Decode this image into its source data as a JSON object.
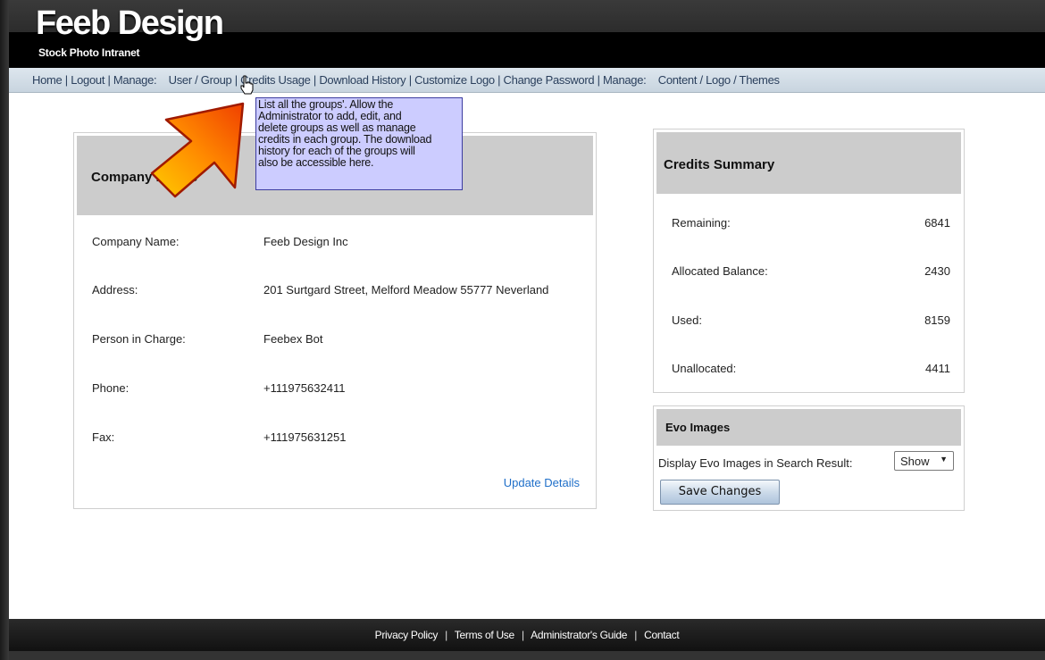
{
  "header": {
    "logo_main": "Feeb Design",
    "logo_sub": "Stock Photo Intranet"
  },
  "nav": {
    "home": "Home",
    "logout": "Logout",
    "manage_label": "Manage:",
    "user": "User",
    "group": "Group",
    "credits_usage": "Credits Usage",
    "download_history": "Download History",
    "customize_logo": "Customize Logo",
    "change_password": "Change Password",
    "manage_label_2": "Manage:",
    "content": "Content",
    "logo": "Logo",
    "themes": "Themes"
  },
  "tooltip": {
    "text": "List all the groups'. Allow the\nAdministrator to add, edit, and\ndelete groups as well as manage\ncredits in each group. The download\nhistory for each of the groups will\nalso be accessible here."
  },
  "company": {
    "title": "Company Profile",
    "rows": [
      {
        "label": "Company Name:",
        "value": "Feeb Design Inc"
      },
      {
        "label": "Address:",
        "value": "201 Surtgard Street, Melford Meadow 55777 Neverland"
      },
      {
        "label": "Person in Charge:",
        "value": "Feebex Bot"
      },
      {
        "label": "Phone:",
        "value": "+111975632411"
      },
      {
        "label": "Fax:",
        "value": "+111975631251"
      }
    ],
    "update_link": "Update Details"
  },
  "credits": {
    "title": "Credits Summary",
    "rows": [
      {
        "label": "Remaining:",
        "value": "6841"
      },
      {
        "label": "Allocated Balance:",
        "value": "2430"
      },
      {
        "label": "Used:",
        "value": "8159"
      },
      {
        "label": "Unallocated:",
        "value": "4411"
      }
    ]
  },
  "evo": {
    "title": "Evo Images",
    "label": "Display Evo Images in Search Result:",
    "selected": "Show",
    "save_label": "Save Changes"
  },
  "footer": {
    "privacy": "Privacy Policy",
    "terms": "Terms of Use",
    "guide": "Administrator's Guide",
    "contact": "Contact"
  },
  "colors": {
    "accent_link": "#1f6fc9",
    "tooltip_bg": "#ccccff",
    "panel_head_bg": "#cccccc"
  }
}
